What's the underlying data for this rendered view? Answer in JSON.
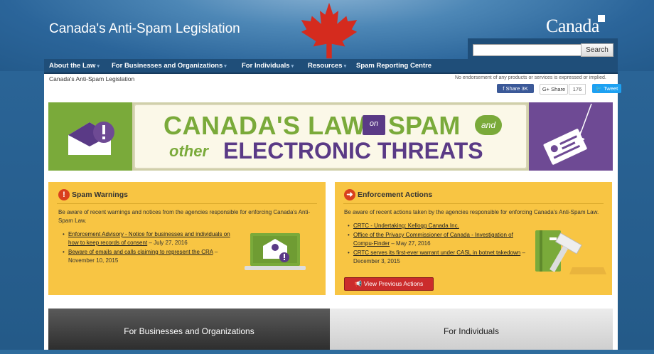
{
  "header": {
    "site_title": "Canada's Anti-Spam Legislation",
    "wordmark": "Canada",
    "search_placeholder": "",
    "search_button": "Search"
  },
  "nav": {
    "items": [
      {
        "label": "About the Law",
        "caret": "▾"
      },
      {
        "label": "For Businesses and Organizations",
        "caret": "▾"
      },
      {
        "label": "For Individuals",
        "caret": "▾"
      },
      {
        "label": "Resources",
        "caret": "▾"
      },
      {
        "label": "Spam Reporting Centre",
        "caret": ""
      }
    ]
  },
  "breadcrumb": "Canada's Anti-Spam Legislation",
  "endorsement": "No endorsement of any products or services is expressed or implied.",
  "share": {
    "facebook": "Share 3K",
    "google": "Share",
    "google_count": "176",
    "twitter": "Tweet"
  },
  "banner": {
    "line1_a": "CANADA'S LAW",
    "line1_on": "on",
    "line1_b": "SPAM",
    "line1_and": "and",
    "line2_a": "other",
    "line2_b": "ELECTRONIC THREATS"
  },
  "spam_warnings": {
    "title": "Spam Warnings",
    "icon": "!",
    "description": "Be aware of recent warnings and notices from the agencies responsible for enforcing Canada's Anti-Spam Law.",
    "items": [
      {
        "link": "Enforcement Advisory - Notice for businesses and individuals on how to keep records of consent",
        "date": " – July 27, 2016"
      },
      {
        "link": "Beware of emails and calls claiming to represent the CRA",
        "date": " – November 10, 2015"
      }
    ]
  },
  "enforcement_actions": {
    "title": "Enforcement Actions",
    "icon": "➜",
    "description": "Be aware of recent actions taken by the agencies responsible for enforcing Canada's Anti-Spam Law.",
    "items": [
      {
        "link": "CRTC - Undertaking: Kellogg Canada Inc.",
        "date": ""
      },
      {
        "link": "Office of the Privacy Commissioner of Canada - Investigation of Compu-Finder",
        "date": " – May 27, 2016"
      },
      {
        "link": "CRTC serves its first-ever warrant under CASL in botnet takedown",
        "date": " – December 3, 2015"
      }
    ],
    "button": "View Previous Actions"
  },
  "audience_tabs": {
    "businesses": "For Businesses and Organizations",
    "individuals": "For Individuals"
  },
  "colors": {
    "panel_yellow": "#f8c543",
    "banner_green": "#7aaa3a",
    "banner_purple": "#5a3a86",
    "nav_blue": "#1f4e79",
    "alert_red": "#d9401d"
  }
}
